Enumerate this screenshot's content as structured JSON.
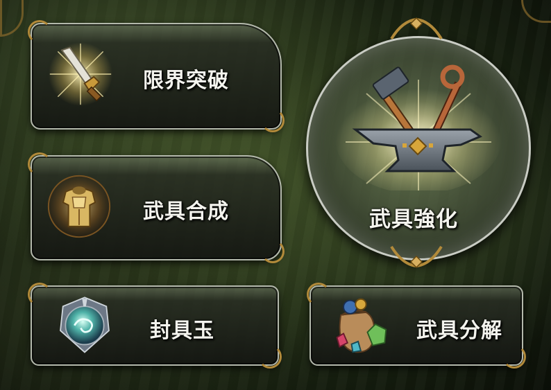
{
  "menu": {
    "limit_break": {
      "label": "限界突破",
      "icon": "glowing-sword-icon"
    },
    "weapon_fusion": {
      "label": "武具合成",
      "icon": "golden-armor-icon"
    },
    "seal_orb": {
      "label": "封具玉",
      "icon": "seal-orb-icon"
    },
    "weapon_dismantle": {
      "label": "武具分解",
      "icon": "material-bag-icon"
    },
    "weapon_enhance": {
      "label": "武具強化",
      "icon": "anvil-hammer-icon"
    }
  },
  "colors": {
    "frame_silver": "#b4b9ac",
    "ornament_gold": "#b28a3a",
    "label_text": "#f4f4ee",
    "background_green": "#243016"
  }
}
